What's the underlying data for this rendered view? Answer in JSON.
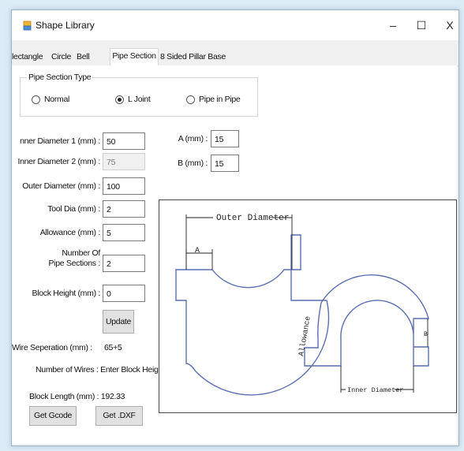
{
  "window": {
    "title": "Shape Library",
    "controls": {
      "minimize": "–",
      "maximize": "☐",
      "close": "X"
    }
  },
  "tabs": [
    {
      "label": "lectangle",
      "active": false
    },
    {
      "label": "Circle",
      "active": false
    },
    {
      "label": "Bell",
      "active": false
    },
    {
      "label": "Pipe Section",
      "active": true
    },
    {
      "label": "8 Sided Pillar Base",
      "active": false
    }
  ],
  "pipe_section_type": {
    "title": "Pipe Section Type",
    "options": [
      {
        "label": "Normal",
        "checked": false
      },
      {
        "label": "L Joint",
        "checked": true
      },
      {
        "label": "Pipe in Pipe",
        "checked": false
      }
    ]
  },
  "fields": {
    "inner_diameter_1": {
      "label": "nner Diameter 1 (mm) :",
      "value": "50"
    },
    "inner_diameter_2": {
      "label": "Inner Diameter 2 (mm) :",
      "value": "75"
    },
    "outer_diameter": {
      "label": "Outer Diameter (mm) :",
      "value": "100"
    },
    "tool_dia": {
      "label": "Tool Dia (mm) :",
      "value": "2"
    },
    "allowance": {
      "label": "Allowance (mm) :",
      "value": "5"
    },
    "pipe_sections": {
      "label_line1": "Number Of",
      "label_line2": "Pipe Sections :",
      "value": "2"
    },
    "block_height": {
      "label": "Block Height (mm) :",
      "value": "0"
    },
    "a": {
      "label": "A (mm) :",
      "value": "15"
    },
    "b": {
      "label": "B (mm) :",
      "value": "15"
    }
  },
  "buttons": {
    "update": "Update",
    "get_gcode": "Get Gcode",
    "get_dxf": "Get .DXF"
  },
  "info": {
    "wire_separation": {
      "label": "Wire Seperation (mm) :",
      "value": "65+5"
    },
    "number_of_wires": "Number of Wires : Enter Block Height!",
    "block_length": "Block Length (mm) : 192.33"
  },
  "diagram": {
    "outer_diameter": "Outer Diameter",
    "a": "A",
    "allowance": "Allowance",
    "b": "B",
    "inner_diameter": "Inner Diameter",
    "line_color": "#5a6fb0"
  }
}
